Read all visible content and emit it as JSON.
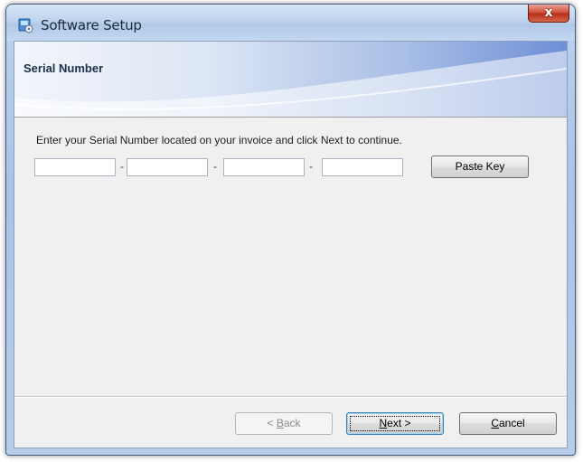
{
  "window": {
    "title": "Software Setup",
    "close_label": "x",
    "title_icon": "setup-installer-icon"
  },
  "banner": {
    "title": "Serial Number"
  },
  "content": {
    "instruction": "Enter your Serial Number located on your invoice and click Next to continue.",
    "serial_fields": [
      {
        "value": "",
        "placeholder": ""
      },
      {
        "value": "",
        "placeholder": ""
      },
      {
        "value": "",
        "placeholder": ""
      },
      {
        "value": "",
        "placeholder": ""
      }
    ],
    "separator": "-",
    "paste_key_label": "Paste Key"
  },
  "footer": {
    "back": {
      "prefix": "< ",
      "mnemonic": "B",
      "rest": "ack",
      "enabled": false
    },
    "next": {
      "mnemonic": "N",
      "rest": "ext >",
      "default": true
    },
    "cancel": {
      "mnemonic": "C",
      "rest": "ancel"
    }
  },
  "colors": {
    "close_button": "#c8412c",
    "client_background": "#f0f0f0",
    "banner_accent": "#6f8fd6"
  }
}
